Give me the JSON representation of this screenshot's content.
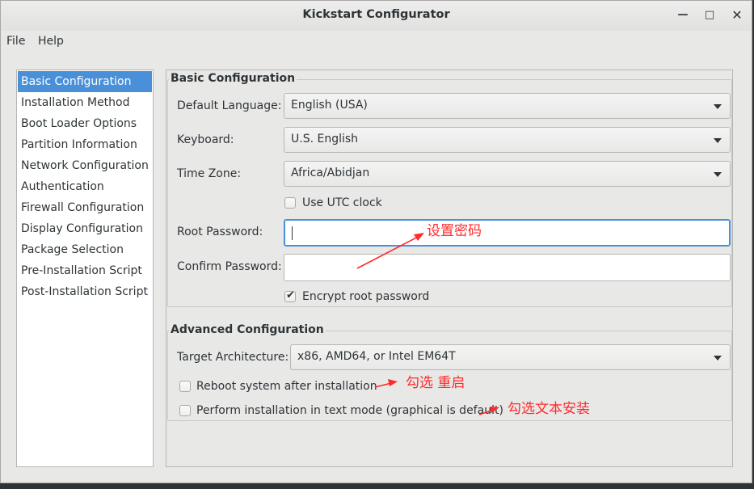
{
  "window": {
    "title": "Kickstart Configurator",
    "minimize_glyph": "—",
    "maximize_glyph": "□",
    "close_glyph": "✕"
  },
  "menubar": {
    "file": "File",
    "help": "Help"
  },
  "sidebar": {
    "selected_index": 0,
    "items": [
      {
        "label": "Basic Configuration"
      },
      {
        "label": "Installation Method"
      },
      {
        "label": "Boot Loader Options"
      },
      {
        "label": "Partition Information"
      },
      {
        "label": "Network Configuration"
      },
      {
        "label": "Authentication"
      },
      {
        "label": "Firewall Configuration"
      },
      {
        "label": "Display Configuration"
      },
      {
        "label": "Package Selection"
      },
      {
        "label": "Pre-Installation Script"
      },
      {
        "label": "Post-Installation Script"
      }
    ]
  },
  "basic": {
    "section_title": "Basic Configuration",
    "default_language_label": "Default Language:",
    "default_language_value": "English (USA)",
    "keyboard_label": "Keyboard:",
    "keyboard_value": "U.S. English",
    "time_zone_label": "Time Zone:",
    "time_zone_value": "Africa/Abidjan",
    "utc_clock_label": "Use UTC clock",
    "utc_clock_checked": false,
    "root_password_label": "Root Password:",
    "root_password_value": "",
    "confirm_password_label": "Confirm Password:",
    "confirm_password_value": "",
    "encrypt_label": "Encrypt root password",
    "encrypt_checked": true
  },
  "advanced": {
    "section_title": "Advanced Configuration",
    "target_arch_label": "Target Architecture:",
    "target_arch_value": "x86, AMD64, or Intel EM64T",
    "reboot_label": "Reboot system after installation",
    "reboot_checked": false,
    "text_mode_label": "Perform installation in text mode (graphical is default)",
    "text_mode_checked": false
  },
  "annotations": {
    "set_password": "设置密码",
    "check_reboot": "勾选  重启",
    "check_text_install": "勾选文本安装",
    "color": "#ff2a2a"
  },
  "colors": {
    "accent": "#4a90d9"
  }
}
